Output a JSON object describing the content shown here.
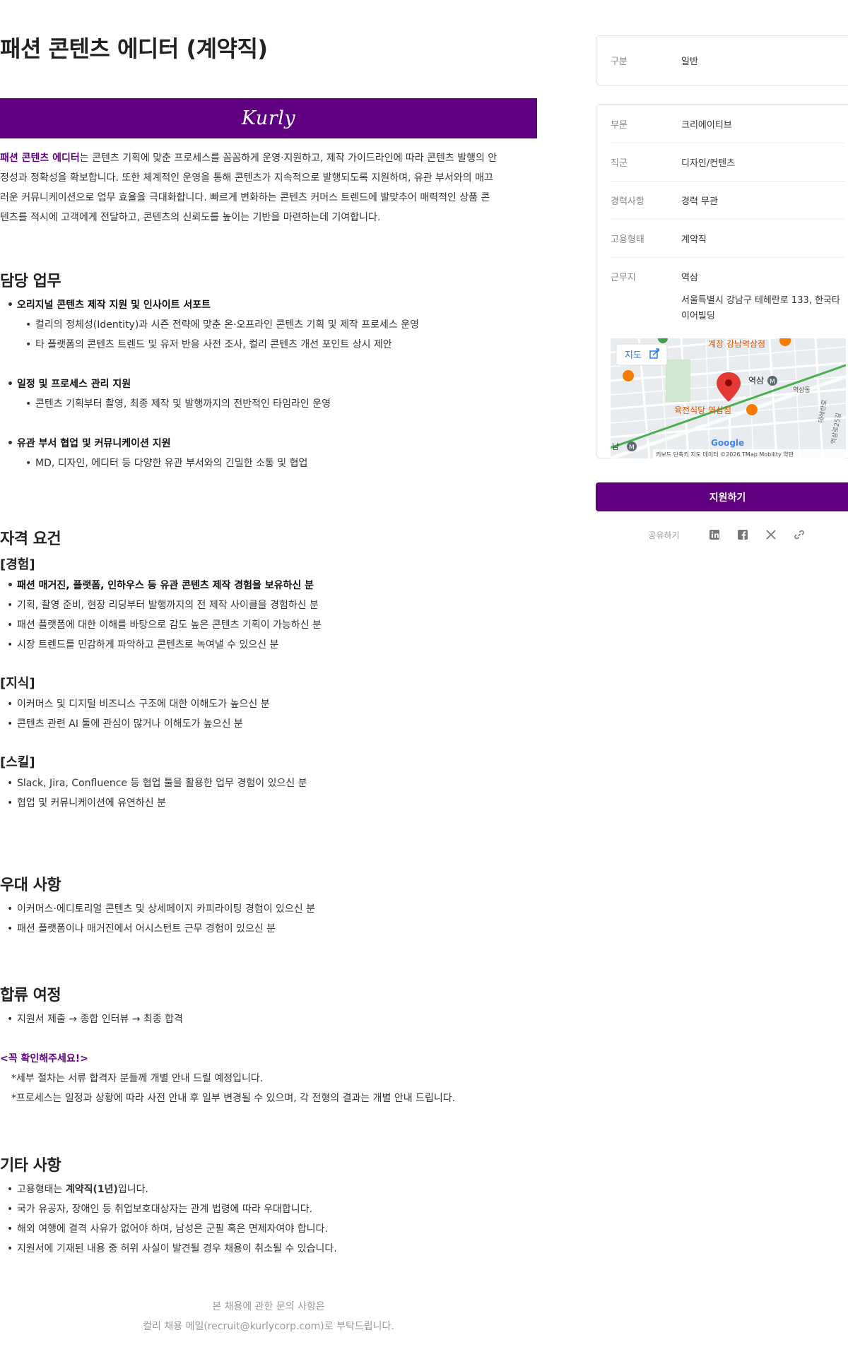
{
  "job": {
    "title": "패션 콘텐츠 에디터 (계약직)",
    "banner_logo": "Kurly",
    "intro_accent": "패션 콘텐츠 에디터",
    "intro_rest_1": "는 콘텐츠 기획에 맞춘 프로세스를 꼼꼼하게 운영·지원하고, 제작 가이드라인에 따라 콘텐츠 발행의 안",
    "intro_line_2": "정성과 정확성을 확보합니다. 또한 체계적인 운영을 통해 콘텐츠가 지속적으로 발행되도록 지원하며, 유관 부서와의 매끄",
    "intro_line_3": "러운 커뮤니케이션으로 업무 효율을 극대화합니다. 빠르게 변화하는 콘텐츠 커머스 트렌드에 발맞추어 매력적인 상품 콘",
    "intro_line_4": "텐츠를 적시에 고객에게 전달하고, 콘텐츠의 신뢰도를 높이는 기반을 마련하는데 기여합니다."
  },
  "duties": {
    "title": "담당 업무",
    "group1_head": "오리지널 콘텐츠 제작 지원 및 인사이트 서포트",
    "group1_items": [
      "컬리의 정체성(Identity)과 시즌 전략에 맞춘 온·오프라인 콘텐츠 기획 및 제작 프로세스 운영",
      "타 플랫폼의 콘텐츠 트렌드 및 유저 반응 사전 조사, 컬리 콘텐츠 개선 포인트 상시 제안"
    ],
    "group2_head": "일정 및 프로세스 관리 지원",
    "group2_items": [
      "콘텐츠 기획부터 촬영, 최종 제작 및 발행까지의 전반적인 타임라인 운영"
    ],
    "group3_head": "유관 부서 협업 및 커뮤니케이션 지원",
    "group3_items": [
      " MD, 디자인, 에디터 등 다양한 유관 부서와의 긴밀한 소통 및 협업"
    ]
  },
  "quals": {
    "title": "자격 요건",
    "exp_title": "[경험]",
    "exp_head": "패션 매거진, 플랫폼, 인하우스 등 유관 콘텐츠 제작 경험을 보유하신 분",
    "exp_items": [
      "기획, 촬영 준비, 현장 리딩부터 발행까지의 전 제작 사이클을 경험하신 분",
      "패션 플랫폼에 대한 이해를 바탕으로 감도 높은 콘텐츠 기획이 가능하신 분",
      "시장 트렌드를 민감하게 파악하고 콘텐츠로 녹여낼 수 있으신 분"
    ],
    "know_title": "[지식]",
    "know_items": [
      "이커머스 및 디지털 비즈니스 구조에 대한 이해도가 높으신 분",
      "콘텐츠 관련 AI 툴에 관심이 많거나 이해도가 높으신 분"
    ],
    "skill_title": "[스킬]",
    "skill_items": [
      "Slack, Jira, Confluence 등 협업 툴을 활용한 업무 경험이 있으신 분",
      "협업 및 커뮤니케이션에 유연하신 분"
    ]
  },
  "prefs": {
    "title": "우대 사항",
    "items": [
      "이커머스·에디토리얼 콘텐츠 및 상세페이지 카피라이팅 경험이 있으신 분",
      "패션 플랫폼이나 매거진에서 어시스턴트 근무 경험이 있으신 분"
    ]
  },
  "process": {
    "title": "합류 여정",
    "steps": " 지원서 제출 → 종합 인터뷰 → 최종 합격",
    "notice": "<꼭 확인해주세요!>",
    "notes": [
      "*세부 절차는 서류 합격자 분들께 개별 안내 드릴 예정입니다.",
      "*프로세스는 일정과 상황에 따라 사전 안내 후 일부 변경될 수 있으며, 각 전형의 결과는 개별 안내 드립니다."
    ]
  },
  "etc": {
    "title": "기타 사항",
    "item1_pre": "고용형태는 ",
    "item1_bold": "계약직(1년)",
    "item1_post": "입니다.",
    "items": [
      "국가 유공자, 장애인 등 취업보호대상자는 관계 법령에 따라 우대합니다.",
      "해외 여행에 결격 사유가 없어야 하며, 남성은 군필 혹은 면제자여야 합니다.",
      "지원서에 기재된 내용 중 허위 사실이 발견될 경우 채용이 취소될 수 있습니다."
    ]
  },
  "footer": {
    "line1": "본 채용에 관한 문의 사항은",
    "line2": "컬리 채용 메일(recruit@kurlycorp.com)로 부탁드립니다."
  },
  "side": {
    "category_label": "구분",
    "category_value": "일반",
    "dept_label": "부문",
    "dept_value": "크리에이티브",
    "role_label": "직군",
    "role_value": "디자인/컨텐츠",
    "career_label": "경력사항",
    "career_value": "경력 무관",
    "emp_label": "고용형태",
    "emp_value": "계약직",
    "loc_label": "근무지",
    "loc_value": "역삼",
    "address_1": "서울특별시 강남구 테헤란로 133, 한국타",
    "address_2": "이어빌딩",
    "apply_button": "지원하기",
    "share_label": "공유하기"
  },
  "map": {
    "map_button": "지도",
    "label_station": "역삼",
    "label_restaurant_1": "계장 강남역삼점",
    "label_restaurant_2": "육전식당 역삼점",
    "label_dong": "역삼동",
    "label_station_left": "남",
    "google": "Google",
    "attribution": "키보드 단축키   지도 데이터 ©2026 TMap Mobility   약관",
    "road_1": "테헤란로",
    "road_2": "역삼로25길"
  },
  "colors": {
    "brand": "#5f0080",
    "apply": "#5f0080",
    "text": "#222222",
    "muted": "#888888"
  }
}
